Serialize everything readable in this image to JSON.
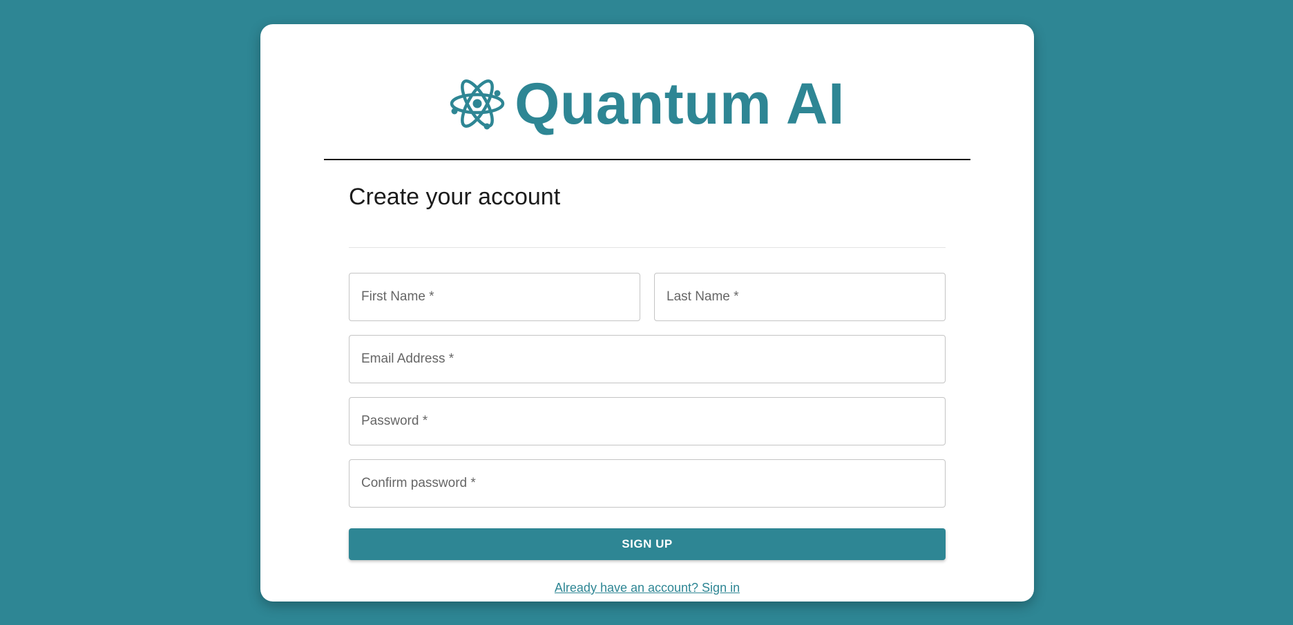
{
  "brand": {
    "name": "Quantum AI",
    "logo_icon": "atom-icon",
    "color": "#2e8694"
  },
  "background_color": "#2e8694",
  "form": {
    "title": "Create your account",
    "fields": {
      "first_name": {
        "placeholder": "First Name *",
        "value": ""
      },
      "last_name": {
        "placeholder": "Last Name *",
        "value": ""
      },
      "email": {
        "placeholder": "Email Address *",
        "value": ""
      },
      "password": {
        "placeholder": "Password *",
        "value": ""
      },
      "confirm_password": {
        "placeholder": "Confirm password *",
        "value": ""
      }
    },
    "submit_label": "SIGN UP",
    "signin_link": "Already have an account? Sign in"
  }
}
